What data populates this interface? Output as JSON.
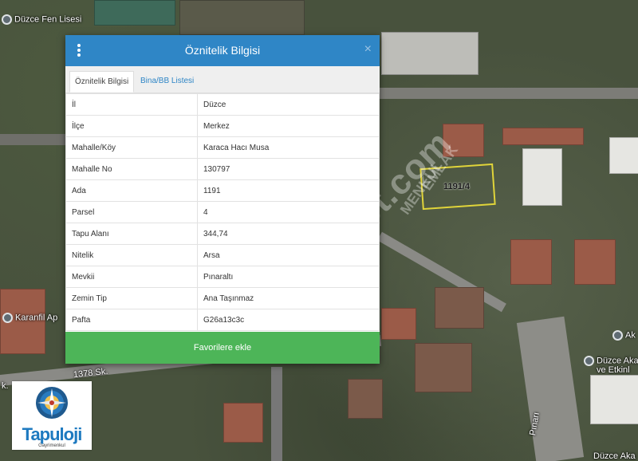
{
  "dialog": {
    "title": "Öznitelik Bilgisi",
    "close": "×",
    "tabs": [
      {
        "label": "Öznitelik Bilgisi",
        "active": true
      },
      {
        "label": "Bina/BB Listesi",
        "active": false
      }
    ],
    "rows": [
      {
        "key": "İl",
        "value": "Düzce"
      },
      {
        "key": "İlçe",
        "value": "Merkez"
      },
      {
        "key": "Mahalle/Köy",
        "value": "Karaca Hacı Musa"
      },
      {
        "key": "Mahalle No",
        "value": "130797"
      },
      {
        "key": "Ada",
        "value": "1191"
      },
      {
        "key": "Parsel",
        "value": "4"
      },
      {
        "key": "Tapu Alanı",
        "value": "344,74"
      },
      {
        "key": "Nitelik",
        "value": "Arsa"
      },
      {
        "key": "Mevkii",
        "value": "Pınaraltı"
      },
      {
        "key": "Zemin Tip",
        "value": "Ana Taşınmaz"
      },
      {
        "key": "Pafta",
        "value": "G26a13c3c"
      }
    ],
    "favorite_button": "Favorilere ekle"
  },
  "map": {
    "parcel_label": "1191/4",
    "places": {
      "fen_lisesi": "Düzce Fen Lisesi",
      "karanfil": "Karanfil Ap",
      "street_1378": "1378 Sk.",
      "akademi": "Düzce Aka",
      "etkinlik": "ve Etkinl",
      "ak": "Ak",
      "pinar": "Pınarı",
      "duzce_aka_bottom": "Düzce Aka",
      "sk_left": "k."
    },
    "watermark": "emlakjet.com",
    "watermark2": "EMLAK",
    "watermark3": "MENKUL"
  },
  "logo": {
    "name": "Tapuloji",
    "subtitle": "Gayrimenkul"
  },
  "colors": {
    "header": "#2f86c6",
    "favorite_button": "#4db558",
    "parcel_outline": "#e0d43a"
  }
}
